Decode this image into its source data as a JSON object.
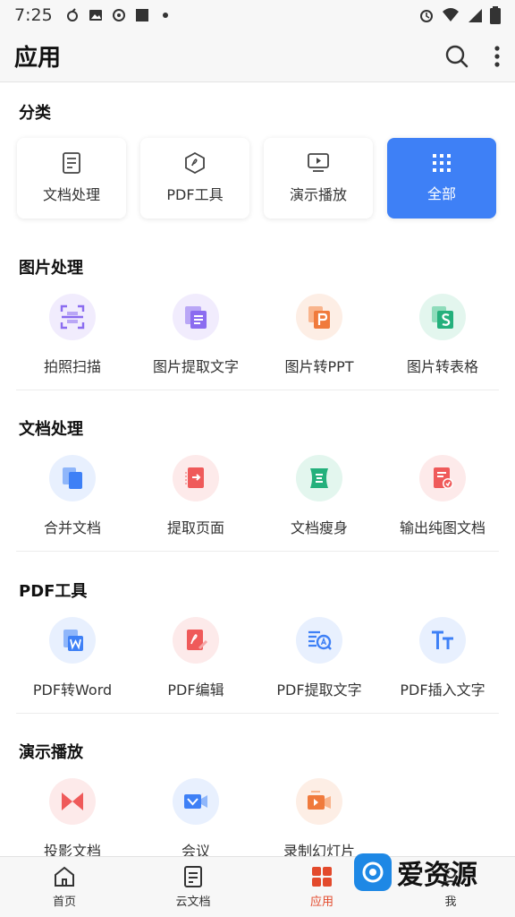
{
  "status_bar": {
    "time": "7:25"
  },
  "app_bar": {
    "title": "应用",
    "search_icon": "search-icon",
    "more_icon": "more-vertical-icon"
  },
  "categories": {
    "title": "分类",
    "items": [
      {
        "label": "文档处理",
        "icon": "document-icon",
        "active": false
      },
      {
        "label": "PDF工具",
        "icon": "pdf-icon",
        "active": false
      },
      {
        "label": "演示播放",
        "icon": "play-screen-icon",
        "active": false
      },
      {
        "label": "全部",
        "icon": "grid-dots-icon",
        "active": true
      }
    ]
  },
  "sections": [
    {
      "title": "图片处理",
      "items": [
        {
          "label": "拍照扫描",
          "icon": "scan-icon",
          "color": "#8b6cf0"
        },
        {
          "label": "图片提取文字",
          "icon": "image-text-icon",
          "color": "#9b6cf0"
        },
        {
          "label": "图片转PPT",
          "icon": "image-to-ppt-icon",
          "color": "#f07a3c"
        },
        {
          "label": "图片转表格",
          "icon": "image-to-sheet-icon",
          "color": "#24b07c"
        }
      ]
    },
    {
      "title": "文档处理",
      "items": [
        {
          "label": "合并文档",
          "icon": "merge-docs-icon",
          "color": "#3e80f6"
        },
        {
          "label": "提取页面",
          "icon": "extract-page-icon",
          "color": "#ef5a5a"
        },
        {
          "label": "文档瘦身",
          "icon": "compress-doc-icon",
          "color": "#24b07c"
        },
        {
          "label": "输出纯图文档",
          "icon": "export-image-doc-icon",
          "color": "#ef5a5a"
        }
      ]
    },
    {
      "title": "PDF工具",
      "items": [
        {
          "label": "PDF转Word",
          "icon": "pdf-to-word-icon",
          "color": "#3e80f6"
        },
        {
          "label": "PDF编辑",
          "icon": "pdf-edit-icon",
          "color": "#ef5a5a"
        },
        {
          "label": "PDF提取文字",
          "icon": "pdf-extract-text-icon",
          "color": "#3e80f6"
        },
        {
          "label": "PDF插入文字",
          "icon": "pdf-insert-text-icon",
          "color": "#3e80f6"
        }
      ]
    },
    {
      "title": "演示播放",
      "items": [
        {
          "label": "投影文档",
          "icon": "projection-icon",
          "color": "#ef5a5a"
        },
        {
          "label": "会议",
          "icon": "meeting-icon",
          "color": "#3e80f6"
        },
        {
          "label": "录制幻灯片",
          "icon": "record-slides-icon",
          "color": "#f07a3c"
        }
      ]
    }
  ],
  "bottom_nav": [
    {
      "label": "首页",
      "icon": "home-icon",
      "active": false
    },
    {
      "label": "云文档",
      "icon": "cloud-doc-icon",
      "active": false
    },
    {
      "label": "应用",
      "icon": "apps-icon",
      "active": true
    },
    {
      "label": "我",
      "icon": "profile-icon",
      "active": false
    }
  ],
  "watermark": {
    "text": "爱资源"
  },
  "colors": {
    "accent": "#3e80f6",
    "active_nav": "#e34a2c"
  }
}
